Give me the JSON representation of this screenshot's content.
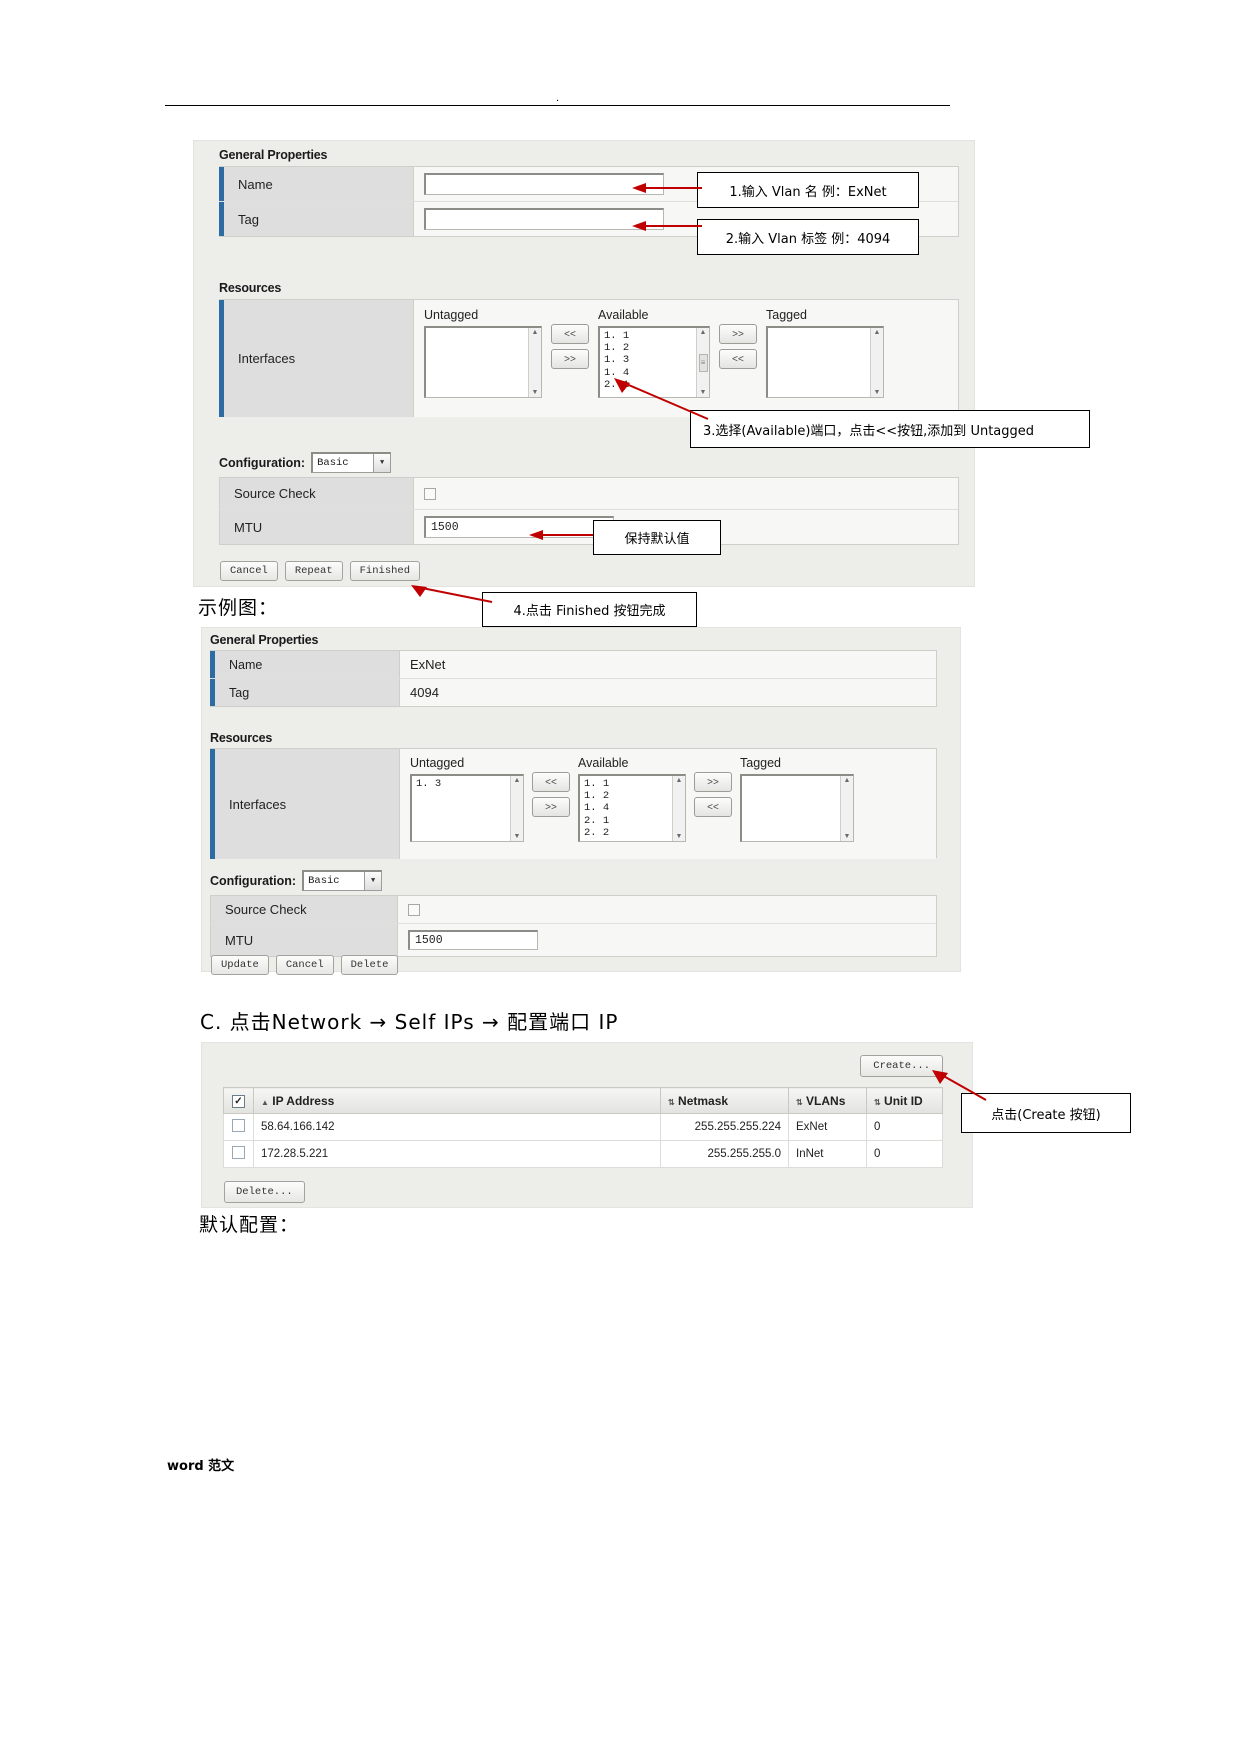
{
  "page": {
    "header_mark": ".",
    "footer_text": "word 范文"
  },
  "form_blank": {
    "general_properties": {
      "title": "General Properties",
      "rows": [
        {
          "label": "Name",
          "value": ""
        },
        {
          "label": "Tag",
          "value": ""
        }
      ]
    },
    "resources": {
      "title": "Resources",
      "row_label": "Interfaces",
      "untagged": {
        "label": "Untagged",
        "items": []
      },
      "available": {
        "label": "Available",
        "items": [
          "1. 1",
          "1. 2",
          "1. 3",
          "1. 4",
          "2. 1"
        ]
      },
      "tagged": {
        "label": "Tagged",
        "items": []
      },
      "btn_left": "<<",
      "btn_right": ">>"
    },
    "configuration": {
      "label": "Configuration:",
      "selected": "Basic",
      "rows": [
        {
          "label": "Source Check",
          "value": ""
        },
        {
          "label": "MTU",
          "value": "1500"
        }
      ]
    },
    "buttons": [
      "Cancel",
      "Repeat",
      "Finished"
    ]
  },
  "callouts": [
    {
      "id": "c1",
      "text": "1.输入 Vlan 名 例：ExNet"
    },
    {
      "id": "c2",
      "text": "2.输入 Vlan 标签 例：4094"
    },
    {
      "id": "c3",
      "text": "3.选择(Available)端口，点击<<按钮,添加到 Untagged"
    },
    {
      "id": "c4",
      "text": "保持默认值"
    },
    {
      "id": "c5",
      "text": "4.点击 Finished 按钮完成"
    },
    {
      "id": "c6",
      "text": "点击(Create 按钮)"
    }
  ],
  "labels": {
    "example_caption": "示例图：",
    "section_c": "C. 点击Network → Self IPs → 配置端口 IP",
    "default_config_caption": "默认配置："
  },
  "form_filled": {
    "general_properties": {
      "title": "General Properties",
      "rows": [
        {
          "label": "Name",
          "value": "ExNet"
        },
        {
          "label": "Tag",
          "value": "4094"
        }
      ]
    },
    "resources": {
      "title": "Resources",
      "row_label": "Interfaces",
      "untagged": {
        "label": "Untagged",
        "items": [
          "1. 3"
        ]
      },
      "available": {
        "label": "Available",
        "items": [
          "1. 1",
          "1. 2",
          "1. 4",
          "2. 1",
          "2. 2"
        ]
      },
      "tagged": {
        "label": "Tagged",
        "items": []
      },
      "btn_left": "<<",
      "btn_right": ">>"
    },
    "configuration": {
      "label": "Configuration:",
      "selected": "Basic",
      "rows": [
        {
          "label": "Source Check",
          "value": ""
        },
        {
          "label": "MTU",
          "value": "1500"
        }
      ]
    },
    "buttons": [
      "Update",
      "Cancel",
      "Delete"
    ]
  },
  "selfips": {
    "create_button": "Create...",
    "delete_button": "Delete...",
    "columns": [
      "IP Address",
      "Netmask",
      "VLANs",
      "Unit ID"
    ],
    "rows": [
      {
        "ip": "58.64.166.142",
        "netmask": "255.255.255.224",
        "vlan": "ExNet",
        "unit": "0"
      },
      {
        "ip": "172.28.5.221",
        "netmask": "255.255.255.0",
        "vlan": "InNet",
        "unit": "0"
      }
    ]
  },
  "colors": {
    "accent_blue": "#2d6ca2",
    "arrow_red": "#c00000",
    "link_blue": "#2a6ca8",
    "panel_bg": "#ededea"
  }
}
